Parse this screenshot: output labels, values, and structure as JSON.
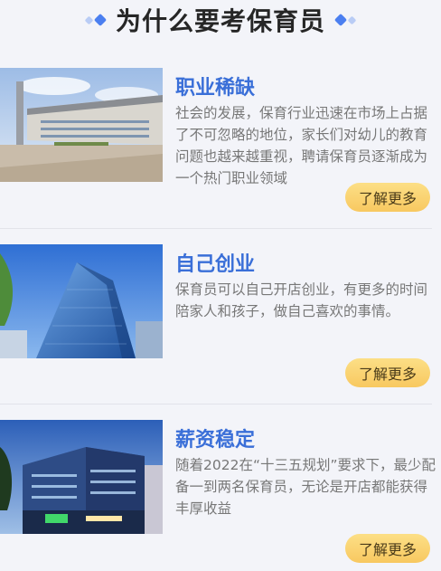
{
  "header": {
    "title": "为什么要考保育员"
  },
  "cards": [
    {
      "title": "职业稀缺",
      "desc": "社会的发展，保育行业迅速在市场上占据了不可忽略的地位，家长们对幼儿的教育问题也越来越重视，聘请保育员逐渐成为一个热门职业领域",
      "button": "了解更多"
    },
    {
      "title": "自己创业",
      "desc": "保育员可以自己开店创业，有更多的时间陪家人和孩子，做自己喜欢的事情。",
      "button": "了解更多"
    },
    {
      "title": "薪资稳定",
      "desc": "随着2022在“十三五规划”要求下，最少配备一到两名保育员，无论是开店都能获得丰厚收益",
      "button": "了解更多"
    }
  ]
}
